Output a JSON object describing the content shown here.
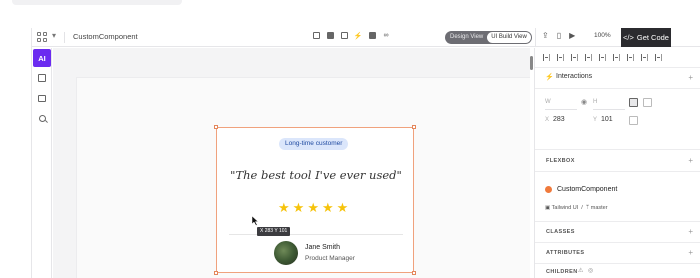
{
  "toolbar": {
    "component_title": "CustomComponent",
    "view_design": "Design View",
    "view_build": "UI Build View",
    "zoom": "100%",
    "get_code": "Get Code"
  },
  "rail": {
    "ai_label": "AI"
  },
  "card": {
    "badge": "Long-time customer",
    "quote": "\"The best tool I've ever used\"",
    "rating": 5,
    "coord_tip": "X 283  Y 101",
    "person_name": "Jane Smith",
    "person_role": "Product Manager"
  },
  "panel": {
    "interactions_label": "Interactions",
    "w_label": "W",
    "h_label": "H",
    "x_label": "X",
    "y_label": "Y",
    "x_value": "283",
    "y_value": "101",
    "flexbox_label": "FLEXBOX",
    "component_name": "CustomComponent",
    "component_lib": "Tailwind UI",
    "component_branch": "master",
    "classes_label": "CLASSES",
    "attributes_label": "ATTRIBUTES",
    "children_label": "CHILDREN"
  },
  "colors": {
    "accent": "#6b2bf0",
    "selection": "#f0a27d",
    "star": "#f6c30b",
    "badge_bg": "#dbe6fb",
    "get_code_bg": "#2b2b2f"
  }
}
